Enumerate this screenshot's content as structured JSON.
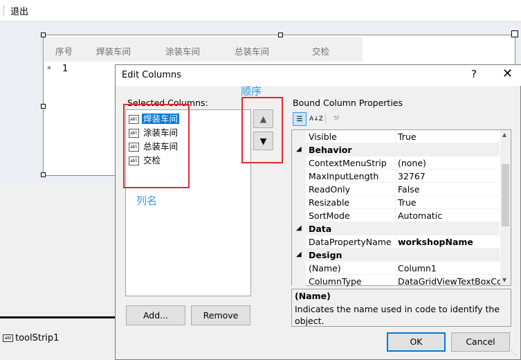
{
  "menu": {
    "exit_label": "退出"
  },
  "datagrid": {
    "headers": [
      "序号",
      "焊装车间",
      "涂装车间",
      "总装车间",
      "交检"
    ],
    "new_row_marker": "*",
    "row_value": "1"
  },
  "toolstrip": {
    "label": "toolStrip1",
    "icon_text": "abl"
  },
  "dialog": {
    "title": "Edit Columns",
    "help_glyph": "?",
    "close_glyph": "✕",
    "selected_columns_label": "Selected Columns:",
    "columns": [
      {
        "icon": "abl",
        "name": "焊装车间",
        "selected": true
      },
      {
        "icon": "abl",
        "name": "涂装车间",
        "selected": false
      },
      {
        "icon": "abl",
        "name": "总装车间",
        "selected": false
      },
      {
        "icon": "abl",
        "name": "交检",
        "selected": false
      }
    ],
    "add_label": "Add...",
    "remove_label": "Remove",
    "bound_properties_label": "Bound Column Properties",
    "properties": [
      {
        "kind": "prop",
        "name": "Visible",
        "value": "True"
      },
      {
        "kind": "cat",
        "name": "Behavior"
      },
      {
        "kind": "prop",
        "name": "ContextMenuStrip",
        "value": "(none)"
      },
      {
        "kind": "prop",
        "name": "MaxInputLength",
        "value": "32767"
      },
      {
        "kind": "prop",
        "name": "ReadOnly",
        "value": "False"
      },
      {
        "kind": "prop",
        "name": "Resizable",
        "value": "True"
      },
      {
        "kind": "prop",
        "name": "SortMode",
        "value": "Automatic"
      },
      {
        "kind": "cat",
        "name": "Data"
      },
      {
        "kind": "prop",
        "name": "DataPropertyName",
        "value": "workshopName",
        "bold": true
      },
      {
        "kind": "cat",
        "name": "Design"
      },
      {
        "kind": "prop",
        "name": "(Name)",
        "value": "Column1"
      },
      {
        "kind": "prop",
        "name": "ColumnType",
        "value": "DataGridViewTextBoxColu"
      }
    ],
    "description": {
      "title": "(Name)",
      "text": "Indicates the name used in code to identify the object."
    },
    "ok_label": "OK",
    "cancel_label": "Cancel"
  },
  "annotations": {
    "order": "顺序",
    "column_names": "列名",
    "box_color": "#e8262c",
    "text_color": "#2aa0e0"
  },
  "colors": {
    "selection": "#0078d7",
    "accent_border": "#0078d7"
  }
}
